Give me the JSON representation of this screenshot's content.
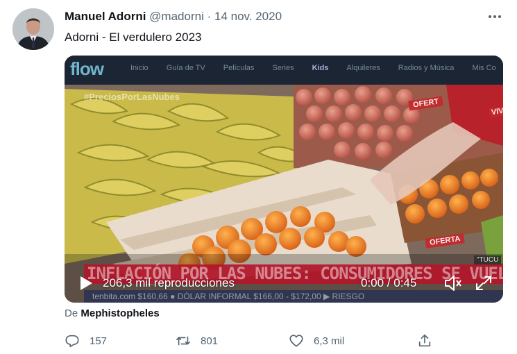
{
  "tweet": {
    "author_name": "Manuel Adorni",
    "handle": "@madorni",
    "separator": "·",
    "date": "14 nov. 2020",
    "text": "Adorni - El verdulero 2023",
    "more_icon": "more-horizontal-icon"
  },
  "video": {
    "overlay_logo": "flow",
    "overlay_nav": [
      "Inicio",
      "Guía de TV",
      "Películas",
      "Series",
      "Kids",
      "Alquileres",
      "Radios y Música",
      "Mis Co"
    ],
    "overlay_hashtag": "#PreciosPorLasNubes",
    "overlay_ofer_1": "OFERT",
    "overlay_ofer_2": "OFERTA",
    "overlay_vivo": "VIV",
    "overlay_tuc": "\"TUCU",
    "ticker_headline": "INFLACIÓN POR LAS NUBES: CONSUMIDORES SE VUELCAN A SEGUNDAS",
    "ticker_secondary": "tenbita.com   $160,66   ● DÓLAR INFORMAL   $166,00 - $172,00   ▶ RIESGO",
    "views_label": "206,3 mil reproducciones",
    "time_label": "0:00 / 0:45",
    "play_icon": "play-icon",
    "volume_icon": "volume-icon",
    "fullscreen_icon": "fullscreen-icon"
  },
  "attribution": {
    "prefix": "De",
    "source": "Mephistopheles"
  },
  "actions": {
    "reply_count": "157",
    "retweet_count": "801",
    "like_count": "6,3 mil",
    "reply_icon": "reply-icon",
    "retweet_icon": "retweet-icon",
    "like_icon": "heart-icon",
    "share_icon": "share-icon"
  },
  "colors": {
    "text_primary": "#0f1419",
    "text_secondary": "#536471",
    "ticker_red": "#b3162a"
  }
}
